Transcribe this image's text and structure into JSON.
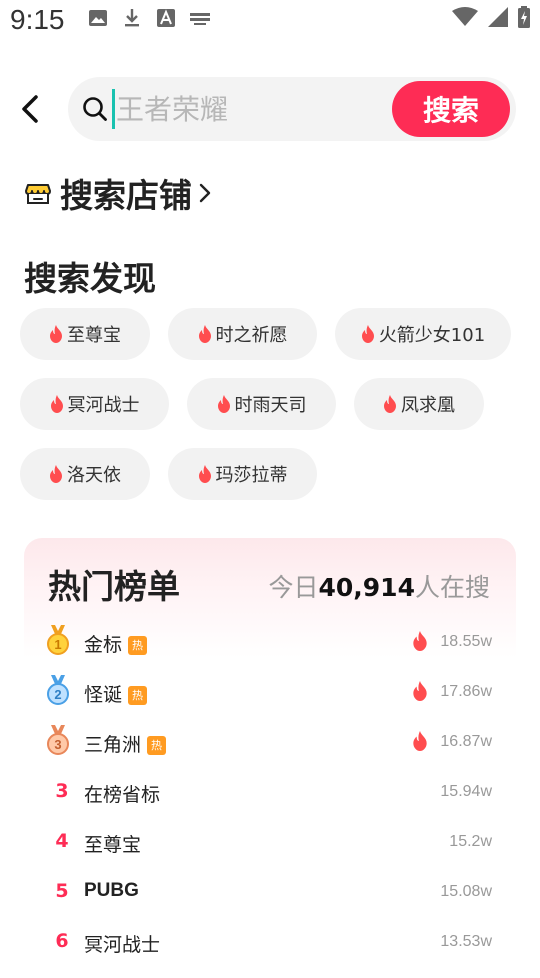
{
  "status_bar": {
    "time": "9:15"
  },
  "search": {
    "placeholder": "王者荣耀",
    "button_label": "搜索"
  },
  "shop_link": {
    "label": "搜索店铺"
  },
  "discover": {
    "title": "搜索发现",
    "items": [
      "至尊宝",
      "时之祈愿",
      "火箭少女101",
      "冥河战士",
      "时雨天司",
      "凤求凰",
      "洛天依",
      "玛莎拉蒂"
    ]
  },
  "hot_list": {
    "title": "热门榜单",
    "stats_prefix": "今日",
    "stats_count": "40,914",
    "stats_suffix": "人在搜",
    "hot_badge": "热",
    "items": [
      {
        "rank": "1",
        "name": "金标",
        "value": "18.55w",
        "hot": true
      },
      {
        "rank": "2",
        "name": "怪诞",
        "value": "17.86w",
        "hot": true
      },
      {
        "rank": "3",
        "name": "三角洲",
        "value": "16.87w",
        "hot": true
      },
      {
        "rank": "3",
        "name": "在榜省标",
        "value": "15.94w",
        "hot": false
      },
      {
        "rank": "4",
        "name": "至尊宝",
        "value": "15.2w",
        "hot": false
      },
      {
        "rank": "5",
        "name": "PUBG",
        "value": "15.08w",
        "hot": false
      },
      {
        "rank": "6",
        "name": "冥河战士",
        "value": "13.53w",
        "hot": false
      }
    ]
  },
  "colors": {
    "accent": "#fe2c55",
    "hot_badge": "#ff9b21",
    "cursor": "#19c2b0"
  }
}
